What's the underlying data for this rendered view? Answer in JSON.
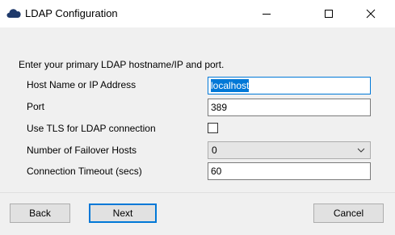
{
  "window": {
    "title": "LDAP Configuration",
    "icon": "cloud-icon",
    "controls": {
      "minimize": "window-minimize-icon",
      "maximize": "window-maximize-icon",
      "close": "window-close-icon"
    }
  },
  "form": {
    "prompt": "Enter your primary LDAP hostname/IP and port.",
    "host": {
      "label": "Host Name or IP Address",
      "value": "localhost"
    },
    "port": {
      "label": "Port",
      "value": "389"
    },
    "tls": {
      "label": "Use TLS for LDAP connection",
      "checked": false
    },
    "failover": {
      "label": "Number of Failover Hosts",
      "value": "0"
    },
    "timeout": {
      "label": "Connection Timeout (secs)",
      "value": "60"
    }
  },
  "buttons": {
    "back": "Back",
    "next": "Next",
    "cancel": "Cancel"
  },
  "colors": {
    "accent": "#0078d7",
    "icon": "#1f3a6b",
    "background": "#f0f0f0"
  }
}
